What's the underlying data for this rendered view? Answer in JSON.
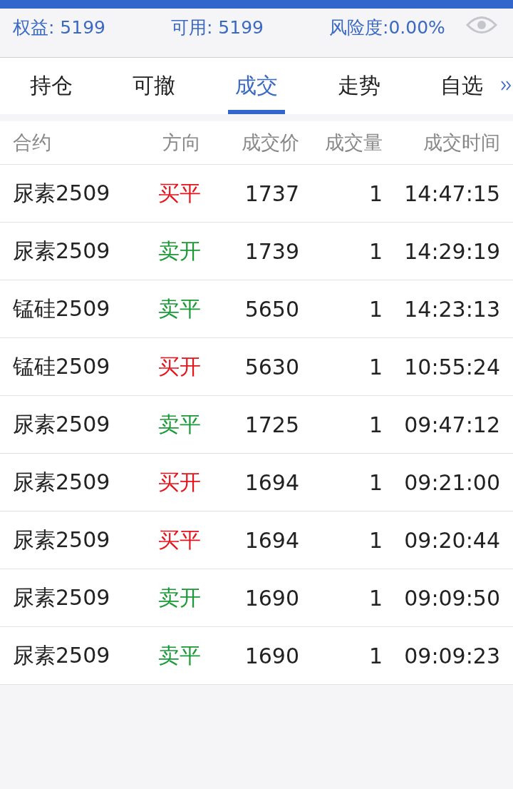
{
  "summary": [
    {
      "label": "权益: 5199"
    },
    {
      "label": "可用: 5199"
    },
    {
      "label": "风险度:0.00%"
    }
  ],
  "tabs": [
    {
      "label": "持仓",
      "selected": false
    },
    {
      "label": "可撤",
      "selected": false
    },
    {
      "label": "成交",
      "selected": true
    },
    {
      "label": "走势",
      "selected": false
    },
    {
      "label": "自选",
      "selected": false
    }
  ],
  "table": {
    "columns": [
      "合约",
      "方向",
      "成交价",
      "成交量",
      "成交时间"
    ],
    "rows": [
      {
        "contract": "尿素2509",
        "direction": "买平",
        "color": "#e8131a",
        "price": "1737",
        "volume": "1",
        "time": "14:47:15"
      },
      {
        "contract": "尿素2509",
        "direction": "卖开",
        "color": "#1a9a37",
        "price": "1739",
        "volume": "1",
        "time": "14:29:19"
      },
      {
        "contract": "锰硅2509",
        "direction": "卖平",
        "color": "#1a9a37",
        "price": "5650",
        "volume": "1",
        "time": "14:23:13"
      },
      {
        "contract": "锰硅2509",
        "direction": "买开",
        "color": "#e8131a",
        "price": "5630",
        "volume": "1",
        "time": "10:55:24"
      },
      {
        "contract": "尿素2509",
        "direction": "卖平",
        "color": "#1a9a37",
        "price": "1725",
        "volume": "1",
        "time": "09:47:12"
      },
      {
        "contract": "尿素2509",
        "direction": "买开",
        "color": "#e8131a",
        "price": "1694",
        "volume": "1",
        "time": "09:21:00"
      },
      {
        "contract": "尿素2509",
        "direction": "买平",
        "color": "#e8131a",
        "price": "1694",
        "volume": "1",
        "time": "09:20:44"
      },
      {
        "contract": "尿素2509",
        "direction": "卖开",
        "color": "#1a9a37",
        "price": "1690",
        "volume": "1",
        "time": "09:09:50"
      },
      {
        "contract": "尿素2509",
        "direction": "卖平",
        "color": "#1a9a37",
        "price": "1690",
        "volume": "1",
        "time": "09:09:23"
      }
    ]
  }
}
